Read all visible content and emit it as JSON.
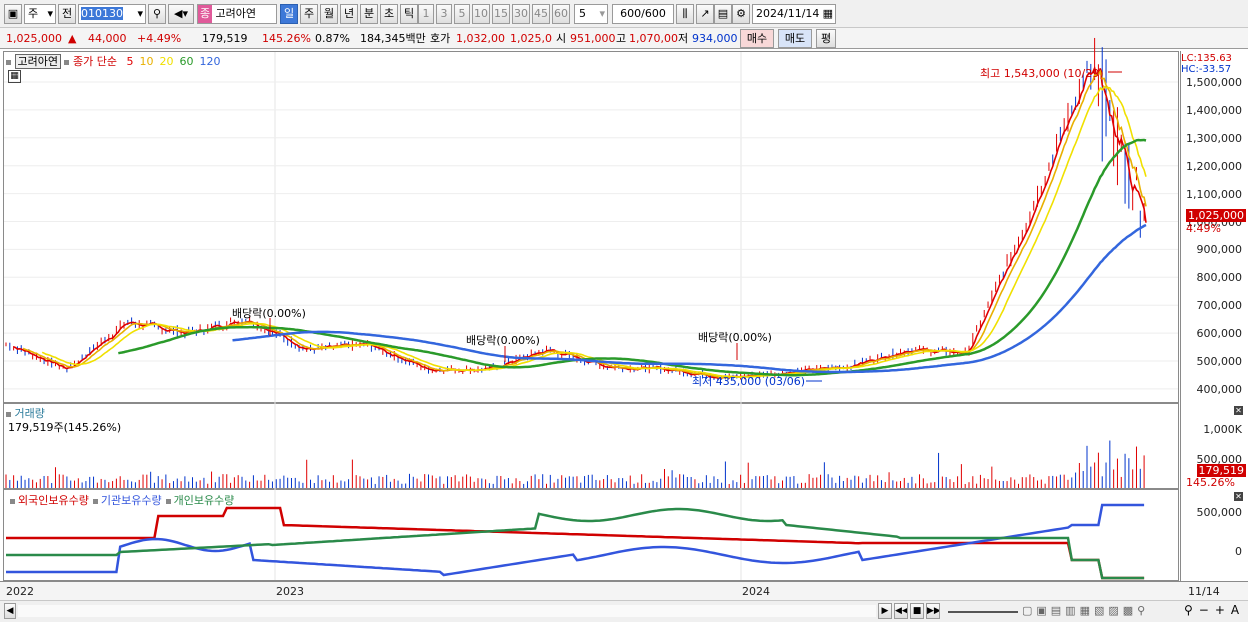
{
  "toolbar": {
    "menu_icon": "window-menu-icon",
    "type_select": "주",
    "prev_label": "전",
    "code": "010130",
    "stock_name": "고려아연",
    "stock_badge": "종",
    "periods": [
      "일",
      "주",
      "월",
      "년",
      "분",
      "초",
      "틱"
    ],
    "active_period": "일",
    "intervals": [
      "1",
      "3",
      "5",
      "10",
      "15",
      "30",
      "45",
      "60"
    ],
    "interval_select": "5",
    "count": "600",
    "count_total": "/600",
    "date": "2024/11/14"
  },
  "quote": {
    "price": "1,025,000",
    "change": "44,000",
    "change_pct": "+4.49%",
    "volume": "179,519",
    "volume_ratio": "145.26%",
    "turnover": "0.87%",
    "amount": "184,345백만",
    "ask_label": "호가",
    "ask": "1,032,00",
    "bid": "1,025,0",
    "open_label": "시",
    "open": "951,000",
    "high_label": "고",
    "high": "1,070,00",
    "low_label": "저",
    "low": "934,000",
    "buy": "매수",
    "sell": "매도",
    "eval": "평"
  },
  "price_panel": {
    "stock_tag": "고려아연",
    "ma_title": "종가 단순",
    "ma_periods": [
      "5",
      "10",
      "20",
      "60",
      "120"
    ],
    "ma_colors": [
      "#e00000",
      "#e8b000",
      "#f0e000",
      "#2a9a2a",
      "#3366dd"
    ],
    "lc": "LC:135.63",
    "hc": "HC:-33.57",
    "current_tag": "1,025,000",
    "current_pct": "4.49%",
    "y_ticks": [
      "1,500,000",
      "1,400,000",
      "1,300,000",
      "1,200,000",
      "1,100,000",
      "1,000,000",
      "900,000",
      "800,000",
      "700,000",
      "600,000",
      "500,000",
      "400,000"
    ],
    "annotations": {
      "high": "최고 1,543,000 (10/29)",
      "low": "최저 435,000 (03/06)",
      "div1": "배당락(0.00%)",
      "div2": "배당락(0.00%)",
      "div3": "배당락(0.00%)"
    }
  },
  "volume_panel": {
    "title": "거래량",
    "value": "179,519주(145.26%)",
    "y_ticks": [
      "1,000K",
      "500,000"
    ],
    "tag": "179,519",
    "tag_pct": "145.26%"
  },
  "holdings_panel": {
    "series": [
      "외국인보유수량",
      "기관보유수량",
      "개인보유수량"
    ],
    "colors": [
      "#d00000",
      "#3355dd",
      "#2a8a4a"
    ],
    "y_ticks": [
      "500,000",
      "0"
    ]
  },
  "x_axis": {
    "labels": [
      "2022",
      "2023",
      "2024"
    ],
    "end_label": "11/14"
  },
  "chart_data": {
    "type": "line",
    "series": [
      {
        "name": "종가",
        "values": [
          560000,
          470000,
          640000,
          600000,
          650000,
          540000,
          560000,
          470000,
          470000,
          540000,
          480000,
          470000,
          440000,
          460000,
          480000,
          540000,
          530000,
          1000000,
          1543000,
          1025000
        ]
      }
    ]
  }
}
